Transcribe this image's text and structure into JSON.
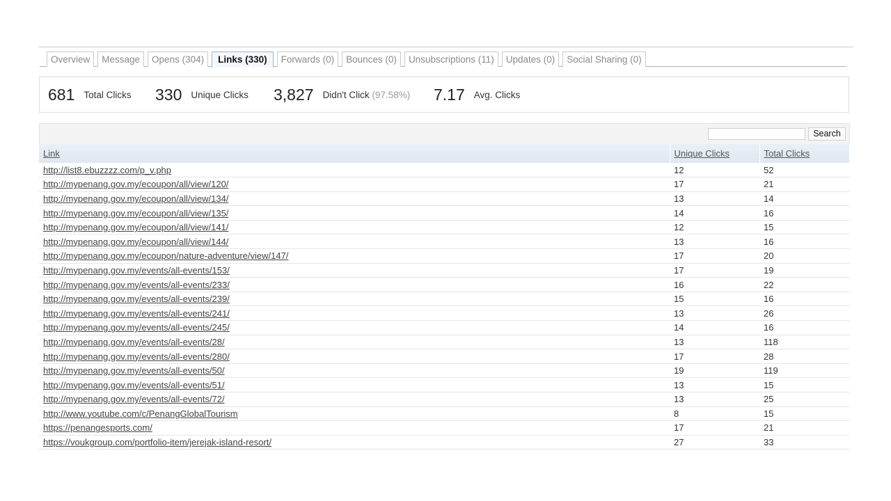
{
  "tabs": [
    {
      "label": "Overview",
      "active": false
    },
    {
      "label": "Message",
      "active": false
    },
    {
      "label": "Opens (304)",
      "active": false
    },
    {
      "label": "Links (330)",
      "active": true
    },
    {
      "label": "Forwards (0)",
      "active": false
    },
    {
      "label": "Bounces (0)",
      "active": false
    },
    {
      "label": "Unsubscriptions (11)",
      "active": false
    },
    {
      "label": "Updates (0)",
      "active": false
    },
    {
      "label": "Social Sharing (0)",
      "active": false
    }
  ],
  "stats": {
    "total_clicks": {
      "value": "681",
      "label": "Total Clicks"
    },
    "unique_clicks": {
      "value": "330",
      "label": "Unique Clicks"
    },
    "didnt_click": {
      "value": "3,827",
      "label": "Didn't Click",
      "percent": "(97.58%)"
    },
    "avg_clicks": {
      "value": "7.17",
      "label": "Avg. Clicks"
    }
  },
  "search": {
    "value": "",
    "button_label": "Search"
  },
  "table": {
    "columns": [
      "Link",
      "Unique Clicks",
      "Total Clicks"
    ],
    "rows": [
      {
        "link": "http://list8.ebuzzzz.com/p_v.php",
        "unique": "12",
        "total": "52"
      },
      {
        "link": "http://mypenang.gov.my/ecoupon/all/view/120/",
        "unique": "17",
        "total": "21"
      },
      {
        "link": "http://mypenang.gov.my/ecoupon/all/view/134/",
        "unique": "13",
        "total": "14"
      },
      {
        "link": "http://mypenang.gov.my/ecoupon/all/view/135/",
        "unique": "14",
        "total": "16"
      },
      {
        "link": "http://mypenang.gov.my/ecoupon/all/view/141/",
        "unique": "12",
        "total": "15"
      },
      {
        "link": "http://mypenang.gov.my/ecoupon/all/view/144/",
        "unique": "13",
        "total": "16"
      },
      {
        "link": "http://mypenang.gov.my/ecoupon/nature-adventure/view/147/",
        "unique": "17",
        "total": "20"
      },
      {
        "link": "http://mypenang.gov.my/events/all-events/153/",
        "unique": "17",
        "total": "19"
      },
      {
        "link": "http://mypenang.gov.my/events/all-events/233/",
        "unique": "16",
        "total": "22"
      },
      {
        "link": "http://mypenang.gov.my/events/all-events/239/",
        "unique": "15",
        "total": "16"
      },
      {
        "link": "http://mypenang.gov.my/events/all-events/241/",
        "unique": "13",
        "total": "26"
      },
      {
        "link": "http://mypenang.gov.my/events/all-events/245/",
        "unique": "14",
        "total": "16"
      },
      {
        "link": "http://mypenang.gov.my/events/all-events/28/",
        "unique": "13",
        "total": "118"
      },
      {
        "link": "http://mypenang.gov.my/events/all-events/280/",
        "unique": "17",
        "total": "28"
      },
      {
        "link": "http://mypenang.gov.my/events/all-events/50/",
        "unique": "19",
        "total": "119"
      },
      {
        "link": "http://mypenang.gov.my/events/all-events/51/",
        "unique": "13",
        "total": "15"
      },
      {
        "link": "http://mypenang.gov.my/events/all-events/72/",
        "unique": "13",
        "total": "25"
      },
      {
        "link": "http://www.youtube.com/c/PenangGlobalTourism",
        "unique": "8",
        "total": "15"
      },
      {
        "link": "https://penangesports.com/",
        "unique": "17",
        "total": "21"
      },
      {
        "link": "https://voukgroup.com/portfolio-item/jerejak-island-resort/",
        "unique": "27",
        "total": "33"
      }
    ]
  }
}
